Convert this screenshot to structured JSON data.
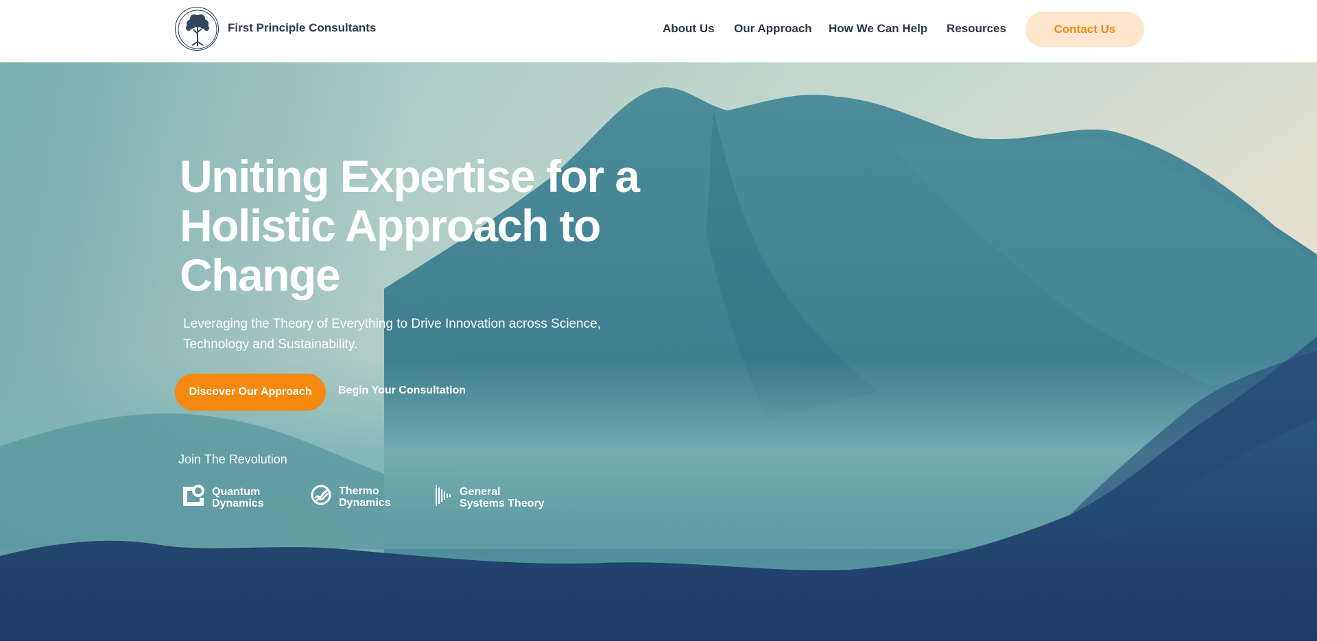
{
  "header": {
    "brand": "First Principle Consultants",
    "logo_icon": "tree-logo-icon",
    "nav": [
      {
        "label": "About Us"
      },
      {
        "label": "Our Approach"
      },
      {
        "label": "How We Can Help"
      },
      {
        "label": "Resources"
      }
    ],
    "contact_label": "Contact Us"
  },
  "hero": {
    "title": "Uniting Expertise for a Holistic Approach to Change",
    "subtitle": "Leveraging the Theory of Everything to Drive Innovation across Science, Technology and Sustainability.",
    "primary_cta": "Discover Our Approach",
    "secondary_cta": "Begin Your Consultation",
    "join_label": "Join The Revolution",
    "partners": [
      {
        "name": "Quantum\nDynamics",
        "icon": "quantum-dynamics-icon"
      },
      {
        "name": "Thermo\nDynamics",
        "icon": "thermo-dynamics-icon"
      },
      {
        "name": "General\nSystems Theory",
        "icon": "general-systems-icon"
      }
    ]
  },
  "colors": {
    "accent": "#f5890f",
    "contact_bg": "#fde6cd",
    "nav_text": "#2c3744"
  }
}
